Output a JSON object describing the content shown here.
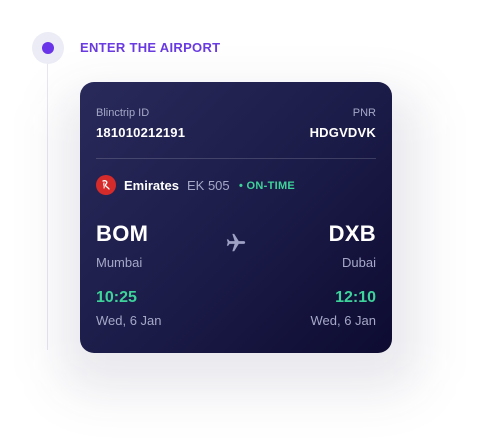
{
  "step": {
    "title": "ENTER THE AIRPORT"
  },
  "booking": {
    "trip_id_label": "Blinctrip ID",
    "trip_id": "181010212191",
    "pnr_label": "PNR",
    "pnr": "HDGVDVK"
  },
  "flight": {
    "airline_icon": "emirates-logo-icon",
    "airline": "Emirates",
    "number": "EK 505",
    "status": "• ON-TIME"
  },
  "departure": {
    "code": "BOM",
    "city": "Mumbai",
    "time": "10:25",
    "date": "Wed, 6 Jan"
  },
  "arrival": {
    "code": "DXB",
    "city": "Dubai",
    "time": "12:10",
    "date": "Wed, 6 Jan"
  },
  "icons": {
    "route": "airplane-icon"
  },
  "colors": {
    "accent": "#6a3be0",
    "card_bg": "#1b1b48",
    "status_green": "#3ed39a",
    "airline_red": "#d52b2b"
  }
}
